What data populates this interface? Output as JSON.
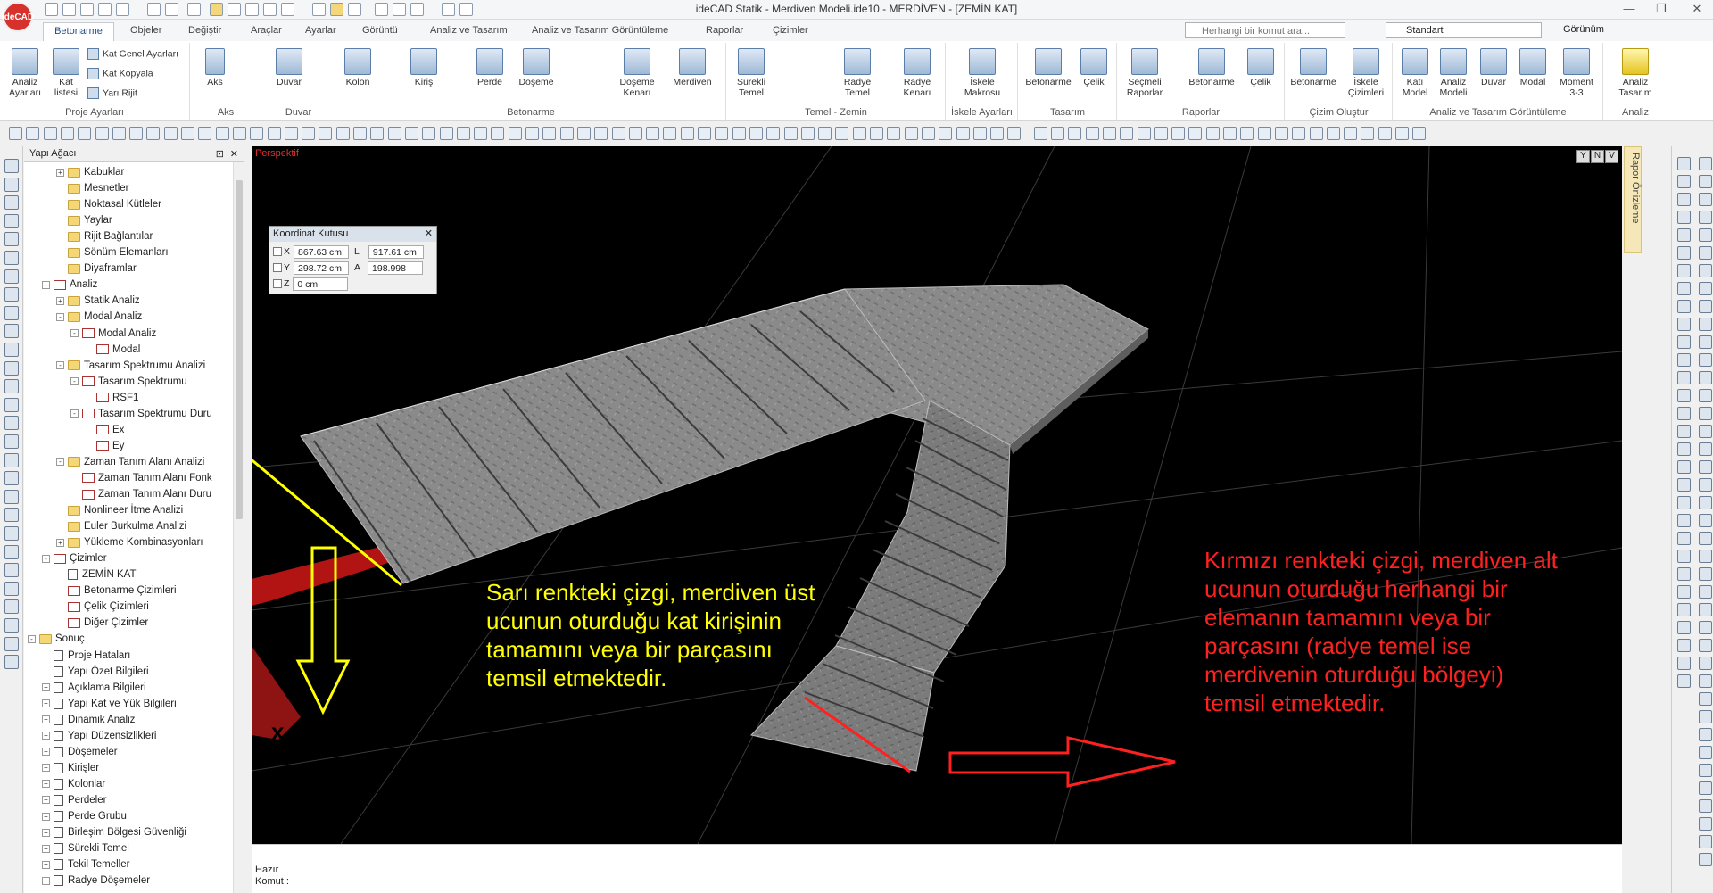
{
  "app": {
    "logo_text": "ideCAD",
    "window_title": "ideCAD Statik - Merdiven Modeli.ide10 - MERDİVEN - [ZEMİN KAT]"
  },
  "tabs": [
    "Betonarme",
    "Objeler",
    "Değiştir",
    "Araçlar",
    "Ayarlar",
    "Görüntü",
    "Analiz ve Tasarım",
    "Analiz ve Tasarım Görüntüleme",
    "Raporlar",
    "Çizimler"
  ],
  "search": {
    "placeholder": "Herhangi bir komut ara..."
  },
  "style_select": {
    "value": "Standart"
  },
  "view_menu": "Görünüm",
  "ribbon": {
    "groups": [
      {
        "label": "Proje Ayarları",
        "buttons": [
          "Analiz Ayarları",
          "Kat listesi"
        ],
        "small": [
          "Kat Genel Ayarları",
          "Kat Kopyala",
          "Yarı Rijit"
        ]
      },
      {
        "label": "Aks",
        "buttons": [
          "Aks"
        ]
      },
      {
        "label": "Duvar",
        "buttons": [
          "Duvar"
        ]
      },
      {
        "label": "Betonarme",
        "buttons": [
          "Kolon",
          "Kiriş",
          "Perde",
          "Döşeme",
          "Döşeme Kenarı",
          "Merdiven"
        ]
      },
      {
        "label": "Temel - Zemin",
        "buttons": [
          "Sürekli Temel",
          "Radye Temel",
          "Radye Kenarı"
        ]
      },
      {
        "label": "İskele Ayarları",
        "buttons": [
          "İskele Makrosu"
        ]
      },
      {
        "label": "Tasarım",
        "buttons": [
          "Betonarme",
          "Çelik"
        ]
      },
      {
        "label": "Raporlar",
        "buttons": [
          "Seçmeli Raporlar",
          "Betonarme",
          "Çelik"
        ]
      },
      {
        "label": "Çizim Oluştur",
        "buttons": [
          "Betonarme",
          "İskele Çizimleri"
        ]
      },
      {
        "label": "Analiz ve Tasarım Görüntüleme",
        "buttons": [
          "Katı Model",
          "Analiz Modeli",
          "Duvar",
          "Modal",
          "Moment 3-3"
        ]
      },
      {
        "label": "Analiz",
        "buttons": [
          "Analiz Tasarım"
        ]
      }
    ]
  },
  "tree": {
    "title": "Yapı Ağacı",
    "items": [
      {
        "label": "Kabuklar",
        "level": 2,
        "icon": "folder",
        "exp": "+"
      },
      {
        "label": "Mesnetler",
        "level": 2,
        "icon": "folder",
        "exp": ""
      },
      {
        "label": "Noktasal Kütleler",
        "level": 2,
        "icon": "folder",
        "exp": ""
      },
      {
        "label": "Yaylar",
        "level": 2,
        "icon": "folder",
        "exp": ""
      },
      {
        "label": "Rijit Bağlantılar",
        "level": 2,
        "icon": "folder",
        "exp": ""
      },
      {
        "label": "Sönüm Elemanları",
        "level": 2,
        "icon": "folder",
        "exp": ""
      },
      {
        "label": "Diyaframlar",
        "level": 2,
        "icon": "folder",
        "exp": ""
      },
      {
        "label": "Analiz",
        "level": 1,
        "icon": "graph",
        "exp": "-"
      },
      {
        "label": "Statik Analiz",
        "level": 2,
        "icon": "folder",
        "exp": "+"
      },
      {
        "label": "Modal Analiz",
        "level": 2,
        "icon": "folder",
        "exp": "-"
      },
      {
        "label": "Modal Analiz",
        "level": 3,
        "icon": "graph",
        "exp": "-"
      },
      {
        "label": "Modal",
        "level": 4,
        "icon": "graph",
        "exp": ""
      },
      {
        "label": "Tasarım Spektrumu Analizi",
        "level": 2,
        "icon": "folder",
        "exp": "-"
      },
      {
        "label": "Tasarım Spektrumu",
        "level": 3,
        "icon": "graph",
        "exp": "-"
      },
      {
        "label": "RSF1",
        "level": 4,
        "icon": "graph",
        "exp": ""
      },
      {
        "label": "Tasarım Spektrumu Duru",
        "level": 3,
        "icon": "graph",
        "exp": "-"
      },
      {
        "label": "Ex",
        "level": 4,
        "icon": "graph",
        "exp": ""
      },
      {
        "label": "Ey",
        "level": 4,
        "icon": "graph",
        "exp": ""
      },
      {
        "label": "Zaman Tanım Alanı Analizi",
        "level": 2,
        "icon": "folder",
        "exp": "-"
      },
      {
        "label": "Zaman Tanım Alanı Fonk",
        "level": 3,
        "icon": "graph",
        "exp": ""
      },
      {
        "label": "Zaman Tanım Alanı Duru",
        "level": 3,
        "icon": "graph",
        "exp": ""
      },
      {
        "label": "Nonlineer İtme Analizi",
        "level": 2,
        "icon": "folder",
        "exp": ""
      },
      {
        "label": "Euler Burkulma Analizi",
        "level": 2,
        "icon": "folder",
        "exp": ""
      },
      {
        "label": "Yükleme Kombinasyonları",
        "level": 2,
        "icon": "folder",
        "exp": "+"
      },
      {
        "label": "Çizimler",
        "level": 1,
        "icon": "graph",
        "exp": "-"
      },
      {
        "label": "ZEMİN KAT",
        "level": 2,
        "icon": "page",
        "exp": ""
      },
      {
        "label": "Betonarme Çizimleri",
        "level": 2,
        "icon": "graph",
        "exp": ""
      },
      {
        "label": "Çelik Çizimleri",
        "level": 2,
        "icon": "graph",
        "exp": ""
      },
      {
        "label": "Diğer Çizimler",
        "level": 2,
        "icon": "graph",
        "exp": ""
      },
      {
        "label": "Sonuç",
        "level": 0,
        "icon": "folder",
        "exp": "-"
      },
      {
        "label": "Proje Hataları",
        "level": 1,
        "icon": "page",
        "exp": ""
      },
      {
        "label": "Yapı Özet Bilgileri",
        "level": 1,
        "icon": "page",
        "exp": ""
      },
      {
        "label": "Açıklama Bilgileri",
        "level": 1,
        "icon": "page",
        "exp": "+"
      },
      {
        "label": "Yapı Kat ve Yük Bilgileri",
        "level": 1,
        "icon": "page",
        "exp": "+"
      },
      {
        "label": "Dinamik Analiz",
        "level": 1,
        "icon": "page",
        "exp": "+"
      },
      {
        "label": "Yapı Düzensizlikleri",
        "level": 1,
        "icon": "page",
        "exp": "+"
      },
      {
        "label": "Döşemeler",
        "level": 1,
        "icon": "page",
        "exp": "+"
      },
      {
        "label": "Kirişler",
        "level": 1,
        "icon": "page",
        "exp": "+"
      },
      {
        "label": "Kolonlar",
        "level": 1,
        "icon": "page",
        "exp": "+"
      },
      {
        "label": "Perdeler",
        "level": 1,
        "icon": "page",
        "exp": "+"
      },
      {
        "label": "Perde Grubu",
        "level": 1,
        "icon": "page",
        "exp": "+"
      },
      {
        "label": "Birleşim Bölgesi Güvenliği",
        "level": 1,
        "icon": "page",
        "exp": "+"
      },
      {
        "label": "Sürekli Temel",
        "level": 1,
        "icon": "page",
        "exp": "+"
      },
      {
        "label": "Tekil Temeller",
        "level": 1,
        "icon": "page",
        "exp": "+"
      },
      {
        "label": "Radye Döşemeler",
        "level": 1,
        "icon": "page",
        "exp": "+"
      }
    ]
  },
  "viewport": {
    "mode_label": "Perspektif",
    "view_buttons": [
      "Y",
      "N",
      "V"
    ],
    "background": "#000000",
    "yellow_text": "Sarı renkteki çizgi, merdiven üst ucunun oturduğu kat kirişinin tamamını veya bir parçasını temsil etmektedir.",
    "red_text": "Kırmızı renkteki çizgi, merdiven alt ucunun oturduğu herhangi bir elemanın tamamını veya bir parçasını (radye temel ise merdivenin oturduğu bölgeyi) temsil etmektedir.",
    "yellow_color": "#ffff00",
    "red_color": "#ff2020"
  },
  "coordinate_box": {
    "title": "Koordinat Kutusu",
    "x_label": "X",
    "x_value": "867.63 cm",
    "l_label": "L",
    "l_value": "917.61 cm",
    "y_label": "Y",
    "y_value": "298.72 cm",
    "a_label": "A",
    "a_value": "198.998",
    "z_label": "Z",
    "z_value": "0 cm"
  },
  "status": {
    "ready": "Hazır",
    "command_label": "Komut :"
  },
  "report_preview_tab": "Rapor Önizleme"
}
